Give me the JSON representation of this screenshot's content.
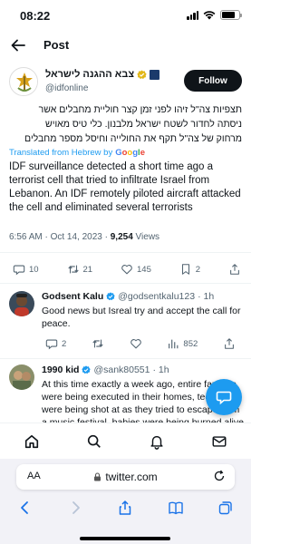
{
  "status_bar": {
    "time": "08:22"
  },
  "header": {
    "title": "Post"
  },
  "author": {
    "name": "צבא ההגנה לישראל",
    "handle": "@idfonline",
    "follow_label": "Follow"
  },
  "post": {
    "hebrew_lines": [
      "תצפיות צה\"ל זיהו לפני זמן קצר חוליית מחבלים אשר",
      "ניסתה לחדור לשטח ישראל מלבנון. כלי טיס מאויש",
      "מרחוק של צה\"ל תקף את החולייה וחיסל מספר מחבלים"
    ],
    "translated_label": "Translated from Hebrew by",
    "google_letters": [
      "G",
      "o",
      "o",
      "g",
      "l",
      "e"
    ],
    "english_text": "IDF surveillance detected a short time ago a terrorist cell that tried to infiltrate Israel from Lebanon. An IDF remotely piloted aircraft attacked the cell and eliminated several terrorists",
    "timestamp": "6:56 AM · Oct 14, 2023 · ",
    "views_count": "9,254",
    "views_label": " Views",
    "actions": {
      "replies": "10",
      "reposts": "21",
      "likes": "145",
      "bookmarks": "2"
    }
  },
  "replies": [
    {
      "name": "Godsent Kalu",
      "handle": "@godsentkalu123",
      "time": "· 1h",
      "text": "Good news but Isreal try and accept the call for peace.",
      "actions": {
        "replies": "2",
        "reposts": "",
        "likes": "",
        "views": "852"
      }
    },
    {
      "name": "1990 kid",
      "handle": "@sank80551",
      "time": "· 1h",
      "text": "At this time exactly a week ago, entire families were being executed in their homes, teenagers were being shot at as they tried to escape from a music festival, babies were being burned alive,"
    }
  ],
  "browser": {
    "aa_label": "AA",
    "url": "twitter.com"
  },
  "colors": {
    "accent": "#1d9bf0",
    "text": "#0f1419",
    "muted": "#536471",
    "verified_gold": "#e2b719"
  }
}
